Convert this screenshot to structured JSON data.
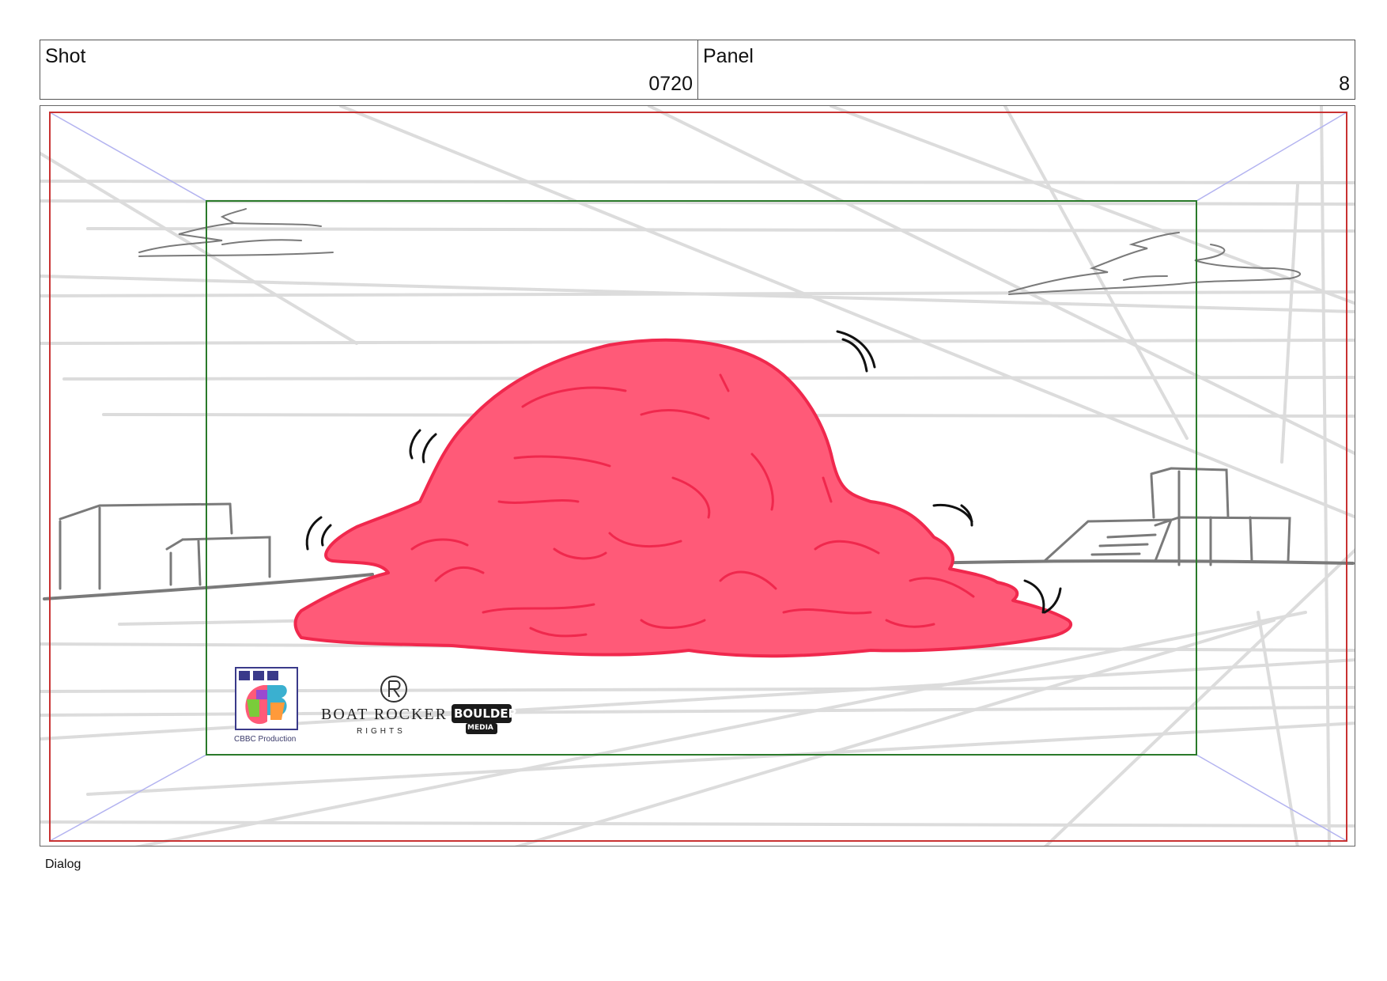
{
  "header": {
    "shot_label": "Shot",
    "shot_value": "0720",
    "panel_label": "Panel",
    "panel_value": "8"
  },
  "logos": {
    "cbbc_text": "CBBC Production",
    "boat_rocker_name": "BOAT ROCKER",
    "boat_rocker_sub": "RIGHTS",
    "boulder_name": "BOULDER",
    "boulder_sub": "MEDIA"
  },
  "footer": {
    "dialog_label": "Dialog"
  },
  "colors": {
    "safe_frame": "#c83232",
    "action_frame": "#2a7a2a",
    "blob": "#ff5a78",
    "blob_outline": "#f0284d",
    "guide": "#dcdcdc",
    "perspective": "#b3b3f0"
  }
}
